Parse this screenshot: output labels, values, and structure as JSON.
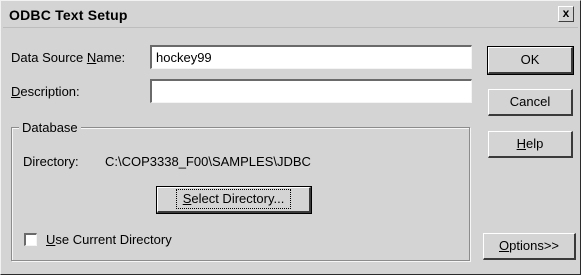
{
  "window": {
    "title": "ODBC Text Setup",
    "close_glyph": "x"
  },
  "form": {
    "dsn_label_pre": "Data Source ",
    "dsn_label_accel": "N",
    "dsn_label_post": "ame:",
    "dsn_value": "hockey99",
    "desc_label_accel": "D",
    "desc_label_post": "escription:",
    "desc_value": ""
  },
  "database": {
    "group_label": "Database",
    "directory_label": "Directory:",
    "directory_value": "C:\\COP3338_F00\\SAMPLES\\JDBC",
    "select_pre": "",
    "select_accel": "S",
    "select_post": "elect Directory...",
    "use_current_accel": "U",
    "use_current_post": "se Current Directory",
    "use_current_checked": false
  },
  "buttons": {
    "ok": "OK",
    "cancel": "Cancel",
    "help_accel": "H",
    "help_post": "elp",
    "options_accel": "O",
    "options_post": "ptions>>"
  }
}
